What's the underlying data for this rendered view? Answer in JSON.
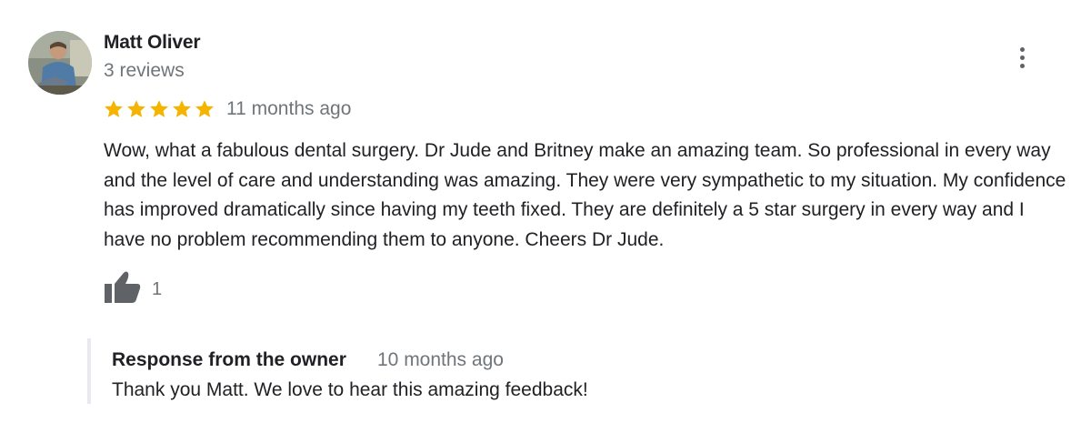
{
  "review": {
    "author": {
      "name": "Matt Oliver",
      "reviews_count": "3 reviews",
      "avatar_icon": "user-photo"
    },
    "rating": 5,
    "star_color": "#f4b400",
    "time_ago": "11 months ago",
    "text": "Wow, what a fabulous dental surgery. Dr Jude and Britney make an amazing team. So professional in every way and the level of care and understanding was amazing. They were very sympathetic to my situation. My confidence has improved dramatically since having my teeth fixed. They are definitely a 5 star surgery in every way and I have no problem recommending them to anyone. Cheers Dr Jude.",
    "likes": "1",
    "actions": {
      "like_icon": "thumbs-up-icon",
      "more_icon": "more-vert-icon"
    }
  },
  "owner_response": {
    "title": "Response from the owner",
    "time_ago": "10 months ago",
    "text": "Thank you Matt. We love to hear this amazing feedback!"
  }
}
